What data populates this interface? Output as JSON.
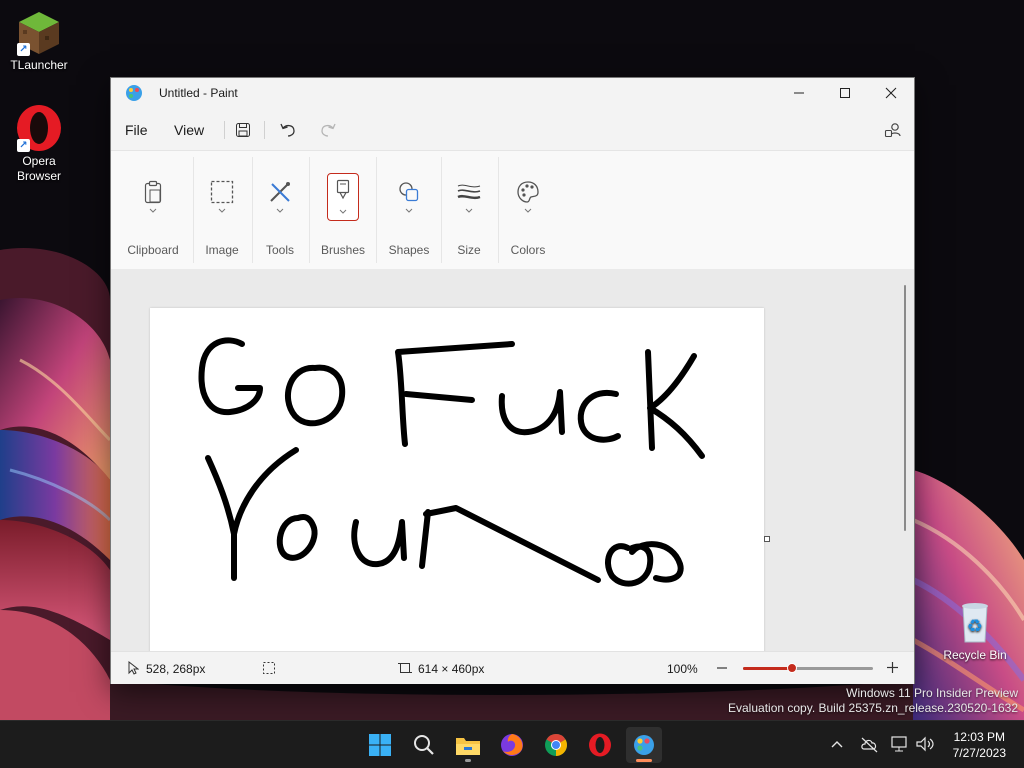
{
  "desktop": {
    "icons": [
      {
        "label": "TLauncher"
      },
      {
        "label": "Opera Browser"
      },
      {
        "label": "Recycle Bin"
      }
    ]
  },
  "window": {
    "title": "Untitled - Paint"
  },
  "menu": {
    "file": "File",
    "view": "View"
  },
  "ribbon": {
    "groups": [
      {
        "label": "Clipboard",
        "icon": "clipboard-icon"
      },
      {
        "label": "Image",
        "icon": "selection-icon"
      },
      {
        "label": "Tools",
        "icon": "tools-icon"
      },
      {
        "label": "Brushes",
        "icon": "brush-icon"
      },
      {
        "label": "Shapes",
        "icon": "shapes-icon"
      },
      {
        "label": "Size",
        "icon": "size-icon"
      },
      {
        "label": "Colors",
        "icon": "palette-icon"
      }
    ]
  },
  "canvas": {
    "handwriting_line1": "Go Fuck",
    "handwriting_line2": "You",
    "ink_color": "#000000"
  },
  "status": {
    "cursor_position": "528, 268px",
    "canvas_size": "614 × 460px",
    "zoom": "100%",
    "zoom_fraction": 0.38
  },
  "watermark": {
    "line1": "Windows 11 Pro Insider Preview",
    "line2": "Evaluation copy. Build 25375.zn_release.230520-1632"
  },
  "taskbar": {
    "time": "12:03 PM",
    "date": "7/27/2023"
  },
  "colors": {
    "accent": "#c42b1c",
    "taskbar": "#1c1c1c"
  }
}
